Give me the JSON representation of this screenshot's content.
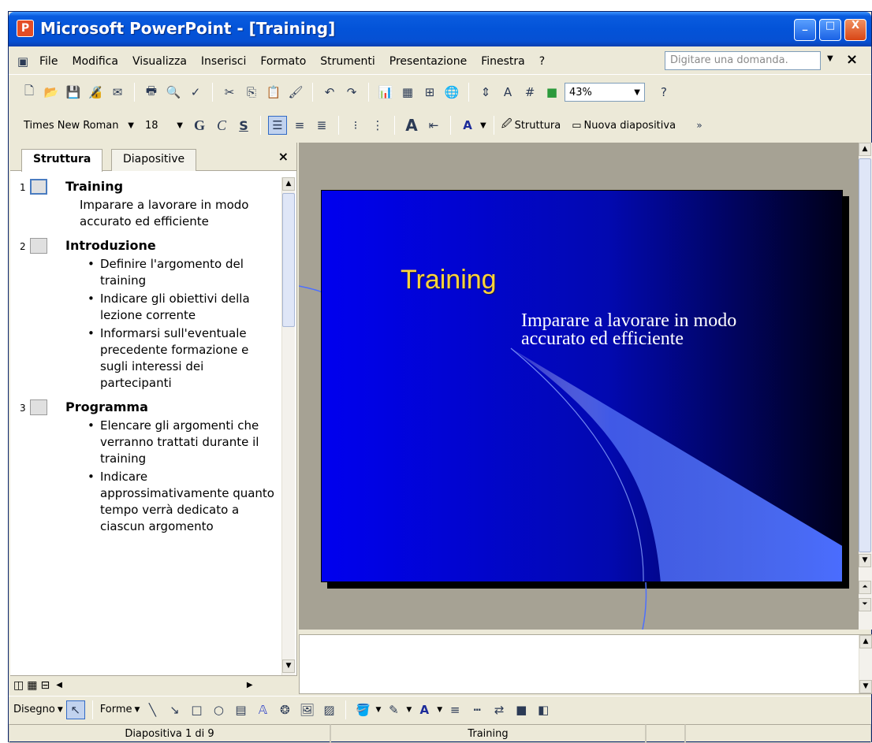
{
  "window": {
    "title": "Microsoft PowerPoint - [Training]",
    "controls": {
      "minimize": "_",
      "maximize": "□",
      "close": "X"
    }
  },
  "menubar": {
    "items": [
      "File",
      "Modifica",
      "Visualizza",
      "Inserisci",
      "Formato",
      "Strumenti",
      "Presentazione",
      "Finestra",
      "?"
    ],
    "help_placeholder": "Digitare una domanda.",
    "close_doc": "×"
  },
  "toolbar_standard": {
    "zoom": "43%"
  },
  "toolbar_formatting": {
    "font": "Times New Roman",
    "size": "18",
    "bold": "G",
    "italic": "C",
    "underline": "S",
    "shadow_letter": "A",
    "design_label": "Struttura",
    "new_slide_label": "Nuova diapositiva"
  },
  "outline_pane": {
    "tabs": [
      "Struttura",
      "Diapositive"
    ],
    "close": "×",
    "slides": [
      {
        "num": "1",
        "title": "Training",
        "body": "Imparare a lavorare in modo accurato ed efficiente"
      },
      {
        "num": "2",
        "title": "Introduzione",
        "bullets": [
          "Definire l'argomento del training",
          "Indicare gli obiettivi della lezione corrente",
          "Informarsi sull'eventuale precedente formazione e sugli interessi dei partecipanti"
        ]
      },
      {
        "num": "3",
        "title": "Programma",
        "bullets": [
          "Elencare gli argomenti che verranno trattati durante il training",
          "Indicare approssimativamente quanto tempo verrà dedicato a ciascun argomento"
        ]
      }
    ]
  },
  "slide": {
    "title": "Training",
    "subtitle": "Imparare a lavorare in modo accurato ed efficiente"
  },
  "drawing_toolbar": {
    "draw_label": "Disegno",
    "shapes_label": "Forme"
  },
  "statusbar": {
    "slide_info": "Diapositiva 1 di 9",
    "design": "Training"
  },
  "colors": {
    "titlebar": "#0353d8",
    "slide_left": "#0000ef",
    "slide_right": "#00001a",
    "slide_title": "#ffd43a"
  }
}
